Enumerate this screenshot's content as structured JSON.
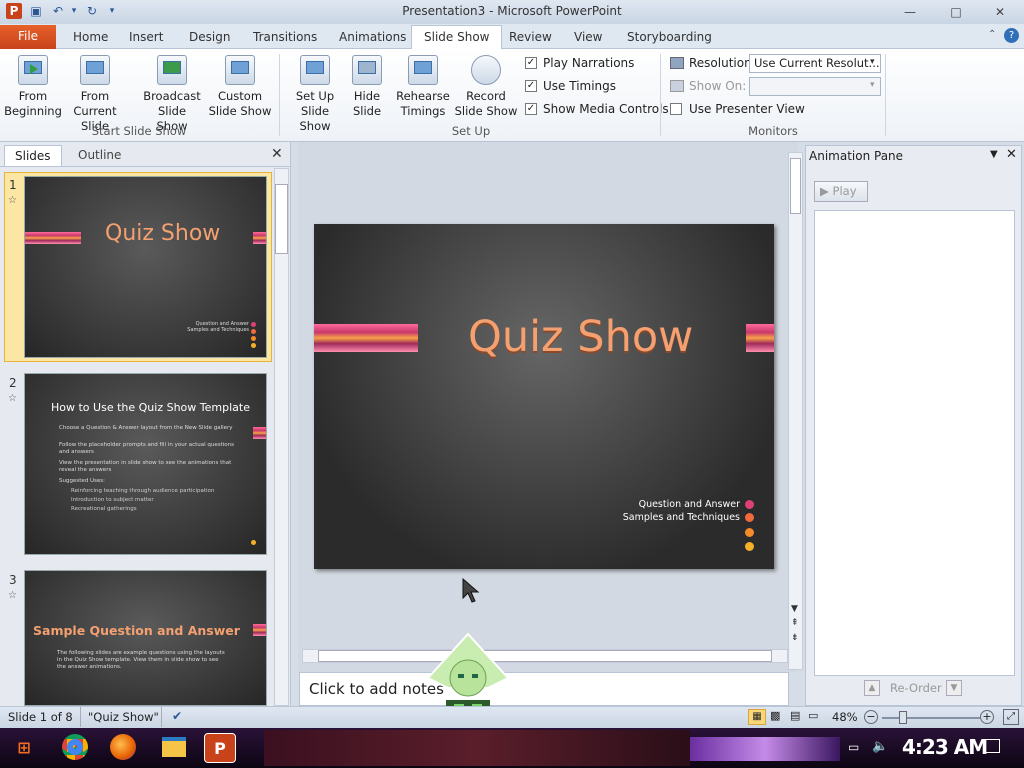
{
  "window": {
    "title": "Presentation3 - Microsoft PowerPoint"
  },
  "tabs": [
    "File",
    "Home",
    "Insert",
    "Design",
    "Transitions",
    "Animations",
    "Slide Show",
    "Review",
    "View",
    "Storyboarding"
  ],
  "ribbon": {
    "start_group": {
      "label": "Start Slide Show",
      "from_beginning": "From Beginning",
      "from_current": "From Current Slide",
      "broadcast": "Broadcast Slide Show",
      "custom": "Custom Slide Show"
    },
    "setup_group": {
      "label": "Set Up",
      "setup_show": "Set Up Slide Show",
      "hide_slide": "Hide Slide",
      "rehearse": "Rehearse Timings",
      "record": "Record Slide Show",
      "play_narrations": "Play Narrations",
      "use_timings": "Use Timings",
      "show_media_controls": "Show Media Controls"
    },
    "monitors_group": {
      "label": "Monitors",
      "resolution_label": "Resolution:",
      "resolution_value": "Use Current Resolut...",
      "show_on_label": "Show On:",
      "presenter_view": "Use Presenter View"
    }
  },
  "slides_pane": {
    "tab_slides": "Slides",
    "tab_outline": "Outline",
    "slides": [
      {
        "num": "1",
        "title": "Quiz Show",
        "lines": [
          "Question and Answer",
          "Samples and Techniques"
        ]
      },
      {
        "num": "2",
        "title": "How to Use the Quiz Show Template",
        "lines": [
          "Choose a Question & Answer layout from the New Slide gallery",
          "Follow the placeholder prompts and fill in your actual questions and answers",
          "View the presentation in slide show to see the animations that reveal the answers",
          "Suggested Uses:",
          "Reinforcing teaching through audience participation",
          "Introduction to subject matter",
          "Recreational gatherings"
        ]
      },
      {
        "num": "3",
        "title": "Sample Question and Answer",
        "lines": [
          "The following slides are example questions using the layouts in the Quiz Show template. View them in slide show to see the answer animations."
        ]
      }
    ]
  },
  "main_slide": {
    "title": "Quiz Show",
    "subtitle_lines": [
      "Question and Answer",
      "Samples and Techniques"
    ],
    "dot_colors": [
      "#e0407a",
      "#f06a3c",
      "#f58a2a",
      "#f5b02a"
    ]
  },
  "notes": {
    "placeholder": "Click to add notes"
  },
  "animation_pane": {
    "title": "Animation Pane",
    "play": "Play",
    "reorder": "Re-Order"
  },
  "status": {
    "slide_info": "Slide 1 of 8",
    "theme": "\"Quiz Show\"",
    "zoom": "48%"
  },
  "taskbar": {
    "clock": "4:23 AM"
  }
}
